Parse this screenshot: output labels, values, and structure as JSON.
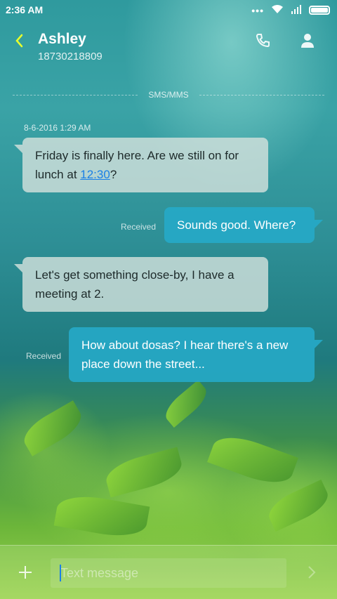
{
  "status_bar": {
    "time": "2:36 AM",
    "icons": [
      "more-dots-icon",
      "wifi-icon",
      "signal-icon",
      "battery-icon"
    ]
  },
  "header": {
    "contact_name": "Ashley",
    "contact_number": "18730218809",
    "icons": [
      "back-chevron-icon",
      "phone-icon",
      "person-icon"
    ]
  },
  "thread": {
    "channel_label": "SMS/MMS",
    "timestamp": "8-6-2016 1:29 AM",
    "messages": [
      {
        "direction": "incoming",
        "text_before": "Friday is finally here. Are we still on for lunch at ",
        "link": "12:30",
        "text_after": "?"
      },
      {
        "direction": "outgoing",
        "text": "Sounds good. Where?",
        "status": "Received"
      },
      {
        "direction": "incoming",
        "text": "Let's get something close-by, I have a meeting at 2."
      },
      {
        "direction": "outgoing",
        "text": "How about dosas? I hear there's a new place down the street...",
        "status": "Received"
      }
    ]
  },
  "composer": {
    "placeholder": "Text message",
    "icons": [
      "plus-icon",
      "send-chevron-icon"
    ]
  },
  "colors": {
    "accent_back": "#e8ff2c",
    "outgoing_bubble": "#26aac8",
    "incoming_bubble": "#d2e1dc",
    "link": "#1a80e6"
  }
}
